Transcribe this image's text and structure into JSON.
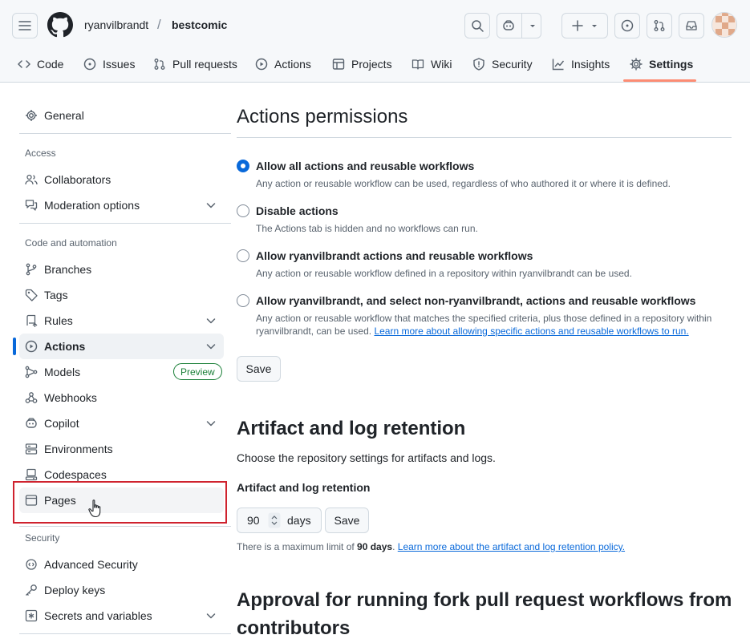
{
  "header": {
    "owner": "ryanvilbrandt",
    "separator": "/",
    "repo": "bestcomic",
    "tabs": [
      {
        "label": "Code",
        "icon": "code-icon"
      },
      {
        "label": "Issues",
        "icon": "issue-icon"
      },
      {
        "label": "Pull requests",
        "icon": "pull-request-icon"
      },
      {
        "label": "Actions",
        "icon": "actions-play-icon"
      },
      {
        "label": "Projects",
        "icon": "table-icon"
      },
      {
        "label": "Wiki",
        "icon": "book-icon"
      },
      {
        "label": "Security",
        "icon": "shield-icon"
      },
      {
        "label": "Insights",
        "icon": "graph-icon"
      },
      {
        "label": "Settings",
        "icon": "gear-icon",
        "selected": true
      }
    ]
  },
  "sidebar": {
    "general": "General",
    "groups": {
      "access": "Access",
      "code_automation": "Code and automation",
      "security": "Security"
    },
    "items": {
      "collaborators": "Collaborators",
      "moderation": "Moderation options",
      "branches": "Branches",
      "tags": "Tags",
      "rules": "Rules",
      "actions": "Actions",
      "models": "Models",
      "models_badge": "Preview",
      "webhooks": "Webhooks",
      "copilot": "Copilot",
      "environments": "Environments",
      "codespaces": "Codespaces",
      "pages": "Pages",
      "advanced_security": "Advanced Security",
      "deploy_keys": "Deploy keys",
      "secrets": "Secrets and variables"
    }
  },
  "main": {
    "permissions_title": "Actions permissions",
    "options": [
      {
        "label": "Allow all actions and reusable workflows",
        "desc": "Any action or reusable workflow can be used, regardless of who authored it or where it is defined.",
        "selected": true
      },
      {
        "label": "Disable actions",
        "desc": "The Actions tab is hidden and no workflows can run.",
        "selected": false
      },
      {
        "label": "Allow ryanvilbrandt actions and reusable workflows",
        "desc": "Any action or reusable workflow defined in a repository within ryanvilbrandt can be used.",
        "selected": false
      },
      {
        "label": "Allow ryanvilbrandt, and select non-ryanvilbrandt, actions and reusable workflows",
        "desc": "Any action or reusable workflow that matches the specified criteria, plus those defined in a repository within ryanvilbrandt, can be used.",
        "link": "Learn more about allowing specific actions and reusable workflows to run.",
        "selected": false
      }
    ],
    "save": "Save",
    "artifact": {
      "title": "Artifact and log retention",
      "subtitle": "Choose the repository settings for artifacts and logs.",
      "field_label": "Artifact and log retention",
      "value": "90",
      "unit": "days",
      "save": "Save",
      "note_prefix": "There is a maximum limit of",
      "note_limit": "90 days",
      "note_suffix": ".",
      "note_link": "Learn more about the artifact and log retention policy."
    },
    "approval_title_line1": "Approval for running fork pull request workflows from",
    "approval_title_line2": "contributors"
  },
  "colors": {
    "accent": "#0969da",
    "selected_tab_underline": "#fd8c73",
    "annotation_red": "#cf222e",
    "preview_green": "#1a7f37"
  }
}
